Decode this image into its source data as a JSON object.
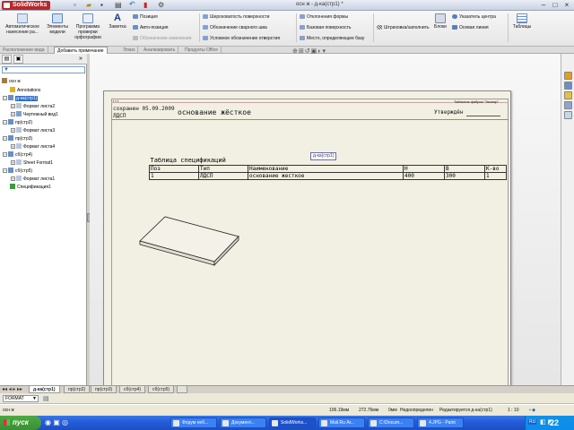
{
  "app": {
    "logo": "SolidWorks",
    "window_title": "осн ж - д-ка(стр1) *"
  },
  "ribbon": {
    "auto_dims": "Автоматическое нанесение ра...",
    "model_items": "Элементы модели",
    "spellcheck": "Программа проверки орфографии",
    "note": "Заметка",
    "balloon": "Позиция",
    "auto_balloon": "Авто-позиция",
    "magnetic_line": "Обозначение изменения",
    "surface_finish": "Шероховатость поверхности",
    "weld_symbol": "Обозначение сварного шва",
    "hole_callout": "Условное обозначение отверстия",
    "geom_tol": "Отклонения формы",
    "datum_feature": "Базовая поверхность",
    "datum_target": "Место, определяющее базу",
    "hatch": "Штриховка/заполнить",
    "blocks": "Блоки",
    "center_mark": "Указатель центра",
    "centerline": "Осевая линия",
    "tables": "Таблицы"
  },
  "cm_tabs": [
    "Расположение вида",
    "Добавить примечание",
    "Эскиз",
    "Анализировать",
    "Продукты Office"
  ],
  "tree": {
    "root": "осн ж",
    "items": [
      {
        "label": "Annotations",
        "icon": "annotations-icon"
      },
      {
        "label": "д-ка(стр1)",
        "icon": "sheet-icon"
      },
      {
        "label": "Формат листа2",
        "icon": "sheet-format-icon"
      },
      {
        "label": "Чертежный вид1",
        "icon": "drawing-view-icon"
      },
      {
        "label": "пр(стр2)",
        "icon": "sheet-icon"
      },
      {
        "label": "Формат листа3",
        "icon": "sheet-format-icon"
      },
      {
        "label": "пр(стр3)",
        "icon": "sheet-icon"
      },
      {
        "label": "Формат листа4",
        "icon": "sheet-format-icon"
      },
      {
        "label": "сб(стр4)",
        "icon": "sheet-icon"
      },
      {
        "label": "Sheet Format1",
        "icon": "sheet-format-icon"
      },
      {
        "label": "сб(стр5)",
        "icon": "sheet-icon"
      },
      {
        "label": "Формат листа1",
        "icon": "sheet-format-icon"
      },
      {
        "label": "Спецификация1",
        "icon": "bom-icon"
      }
    ]
  },
  "drawing": {
    "header_small": "Тайльник фабрик \"Эконир\"",
    "date_line": "сохранен 05.09.2009",
    "material_short": "ЛДСП",
    "part_title": "основание жёсткое",
    "approved": "Утверждён",
    "view_label": "д-ка(стр1)",
    "table_title": "Таблица спецификаций",
    "columns": [
      "Поз",
      "Тип",
      "Наименование",
      "Н",
      "В",
      "К-во"
    ],
    "rows": [
      [
        "1",
        "ЛДСП",
        "основание жесткое",
        "400",
        "300",
        "1"
      ]
    ]
  },
  "sheet_tabs": [
    "д-ка(стр1)",
    "пр(стр2)",
    "пр(стр3)",
    "сб(стр4)",
    "сб(стр5)"
  ],
  "format_bar": {
    "selected": "FORMAT"
  },
  "status": {
    "doc": "осн ж",
    "x": "106.19мм",
    "y": "272.76мм",
    "z": "0мм",
    "state": "Недоопределен",
    "editing": "Редактируется д-ка(стр1)",
    "scale": "1 : 10"
  },
  "taskbar": {
    "start": "пуск",
    "items": [
      "Форум неб...",
      "Документ...",
      "SolidWorks...",
      "Mail.Ru Аг...",
      "C:\\Docum...",
      "4.JPG - Paint"
    ],
    "active_index": 2,
    "lang": "RU",
    "clock": "22"
  },
  "colors": {
    "accent": "#316ac5",
    "taskbar": "#245edb",
    "start": "#3a8f33",
    "logo": "#b8282a"
  }
}
